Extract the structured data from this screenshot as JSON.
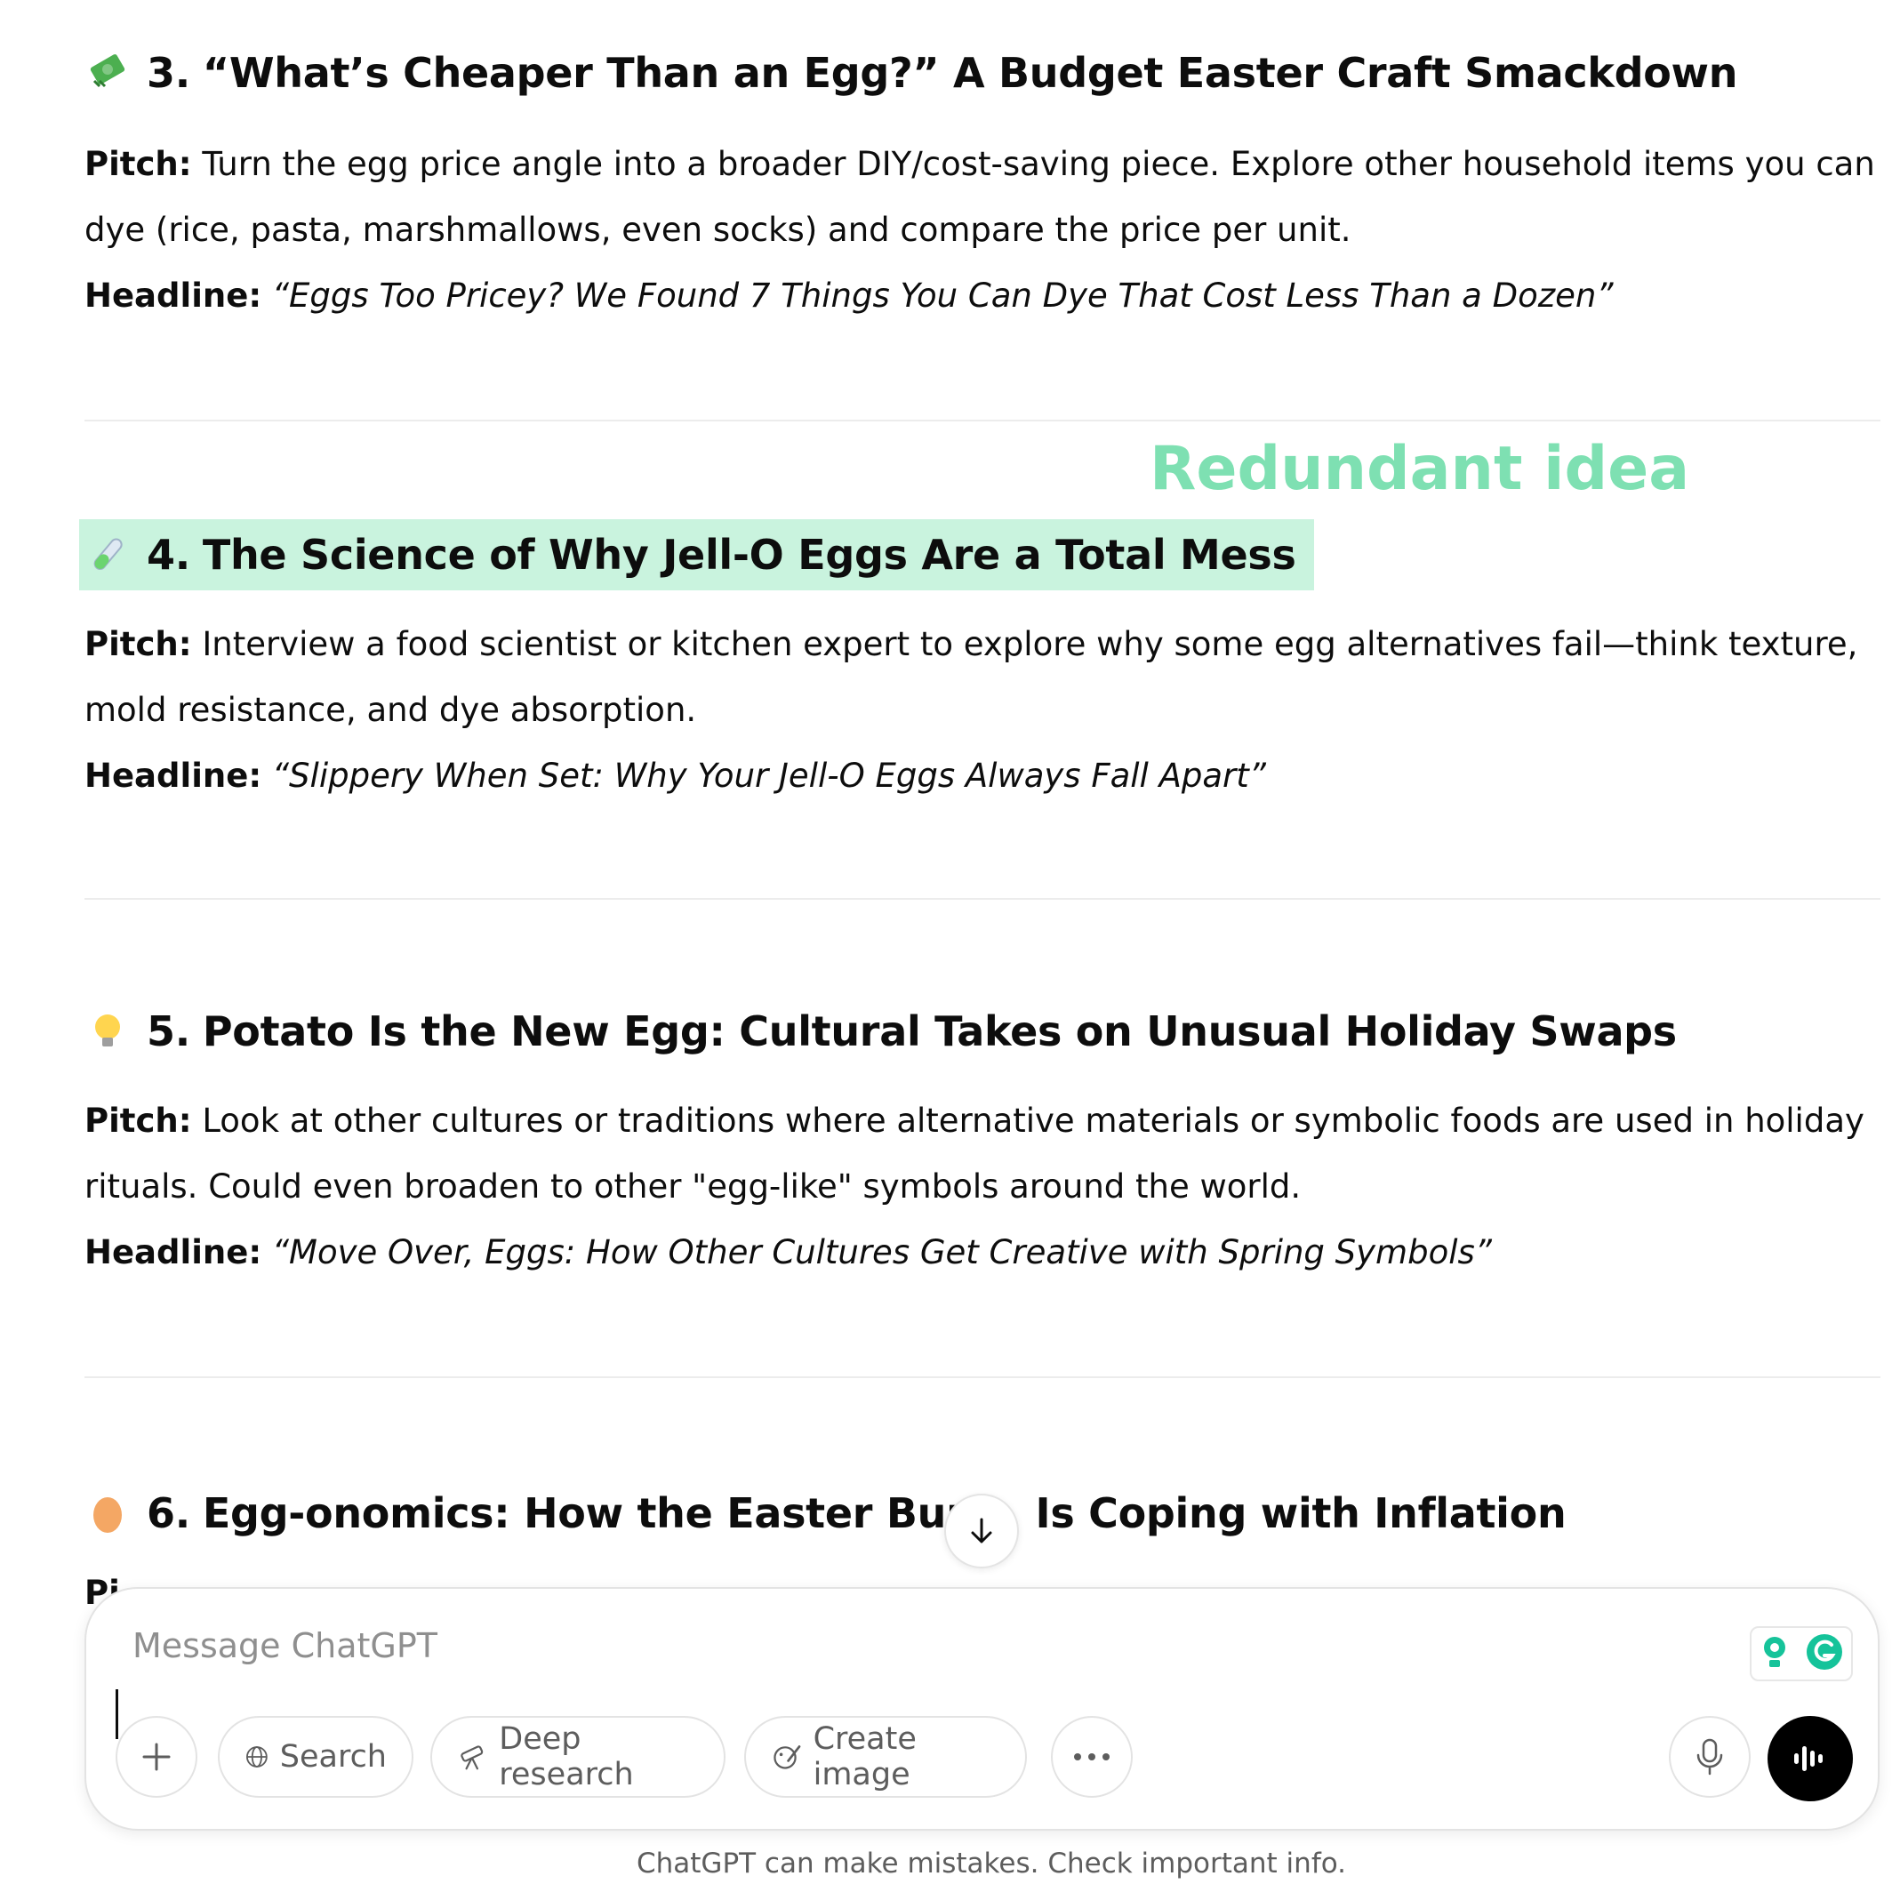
{
  "annotation": "Redundant idea",
  "sections": [
    {
      "emoji": "money-with-wings",
      "number": "3.",
      "title": "“What’s Cheaper Than an Egg?” A Budget Easter Craft Smackdown",
      "pitch_label": "Pitch:",
      "pitch_line1": "Turn the egg price angle into a broader DIY/cost-saving piece. Explore other household items you can",
      "pitch_line2": "dye (rice, pasta, marshmallows, even socks) and compare the price per unit.",
      "headline_label": "Headline:",
      "headline": "“Eggs Too Pricey? We Found 7 Things You Can Dye That Cost Less Than a Dozen”"
    },
    {
      "emoji": "test-tube",
      "number": "4.",
      "title": "The Science of Why Jell-O Eggs Are a Total Mess",
      "pitch_label": "Pitch:",
      "pitch_line1": "Interview a food scientist or kitchen expert to explore why some egg alternatives fail—think texture,",
      "pitch_line2": "mold resistance, and dye absorption.",
      "headline_label": "Headline:",
      "headline": "“Slippery When Set: Why Your Jell-O Eggs Always Fall Apart”"
    },
    {
      "emoji": "light-bulb",
      "number": "5.",
      "title": "Potato Is the New Egg: Cultural Takes on Unusual Holiday Swaps",
      "pitch_label": "Pitch:",
      "pitch_line1": "Look at other cultures or traditions where alternative materials or symbolic foods are used in holiday",
      "pitch_line2": "rituals. Could even broaden to other \"egg-like\" symbols around the world.",
      "headline_label": "Headline:",
      "headline": "“Move Over, Eggs: How Other Cultures Get Creative with Spring Symbols”"
    },
    {
      "emoji": "egg",
      "number": "6.",
      "title_part1": "Egg-onomics: How the Easter Bun",
      "title_part2": "Is Coping with Inflation",
      "pitch_label": "Pi"
    }
  ],
  "composer": {
    "placeholder": "Message ChatGPT",
    "buttons": {
      "search": "Search",
      "deep_research": "Deep research",
      "create_image": "Create image"
    }
  },
  "footer": "ChatGPT can make mistakes. Check important info.",
  "colors": {
    "highlight": "#c9f3de",
    "annotation": "#7ee0b2"
  }
}
